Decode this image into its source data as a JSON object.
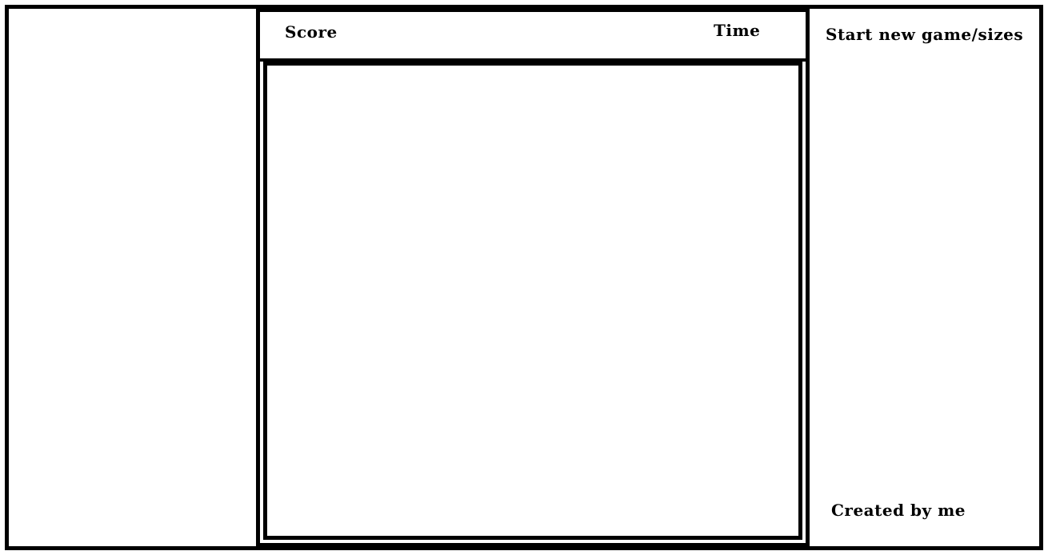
{
  "header": {
    "score_label": "Score",
    "time_label": "Time"
  },
  "sidebar": {
    "new_game_label": "Start new game/sizes",
    "credits": "Created by me"
  },
  "colors": {
    "border": "#000000",
    "background": "#ffffff"
  }
}
